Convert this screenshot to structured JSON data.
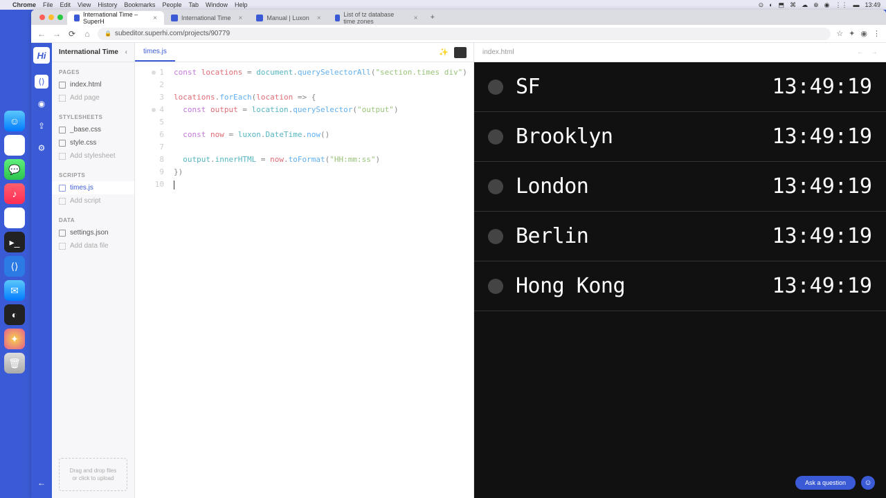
{
  "mac": {
    "app": "Chrome",
    "menus": [
      "File",
      "Edit",
      "View",
      "History",
      "Bookmarks",
      "People",
      "Tab",
      "Window",
      "Help"
    ],
    "time": "13:49"
  },
  "browser": {
    "tabs": [
      {
        "title": "International Time – SuperH",
        "active": true
      },
      {
        "title": "International Time",
        "active": false
      },
      {
        "title": "Manual | Luxon",
        "active": false
      },
      {
        "title": "List of tz database time zones",
        "active": false
      }
    ],
    "url": "subeditor.superhi.com/projects/90779"
  },
  "project": {
    "name": "International Time"
  },
  "sidebar": {
    "sections": {
      "pages": {
        "label": "PAGES",
        "items": [
          "index.html"
        ],
        "add": "Add page"
      },
      "stylesheets": {
        "label": "STYLESHEETS",
        "items": [
          "_base.css",
          "style.css"
        ],
        "add": "Add stylesheet"
      },
      "scripts": {
        "label": "SCRIPTS",
        "items": [
          "times.js"
        ],
        "add": "Add script"
      },
      "data": {
        "label": "DATA",
        "items": [
          "settings.json"
        ],
        "add": "Add data file"
      }
    },
    "dropzone_line1": "Drag and drop files",
    "dropzone_line2": "or click to upload"
  },
  "editor": {
    "active_file": "times.js",
    "lines": [
      {
        "n": 1,
        "dot": true,
        "segments": [
          [
            "kw",
            "const "
          ],
          [
            "var",
            "locations"
          ],
          [
            "pun",
            " = "
          ],
          [
            "prop",
            "document"
          ],
          [
            "pun",
            "."
          ],
          [
            "fn",
            "querySelectorAll"
          ],
          [
            "pun",
            "("
          ],
          [
            "str",
            "\"section.times div\""
          ],
          [
            "pun",
            ")"
          ]
        ]
      },
      {
        "n": 2,
        "segments": []
      },
      {
        "n": 3,
        "segments": [
          [
            "var",
            "locations"
          ],
          [
            "pun",
            "."
          ],
          [
            "fn",
            "forEach"
          ],
          [
            "pun",
            "("
          ],
          [
            "var",
            "location"
          ],
          [
            "pun",
            " => {"
          ]
        ]
      },
      {
        "n": 4,
        "dot": true,
        "indent": 1,
        "segments": [
          [
            "kw",
            "const "
          ],
          [
            "var",
            "output"
          ],
          [
            "pun",
            " = "
          ],
          [
            "prop",
            "location"
          ],
          [
            "pun",
            "."
          ],
          [
            "fn",
            "querySelector"
          ],
          [
            "pun",
            "("
          ],
          [
            "str",
            "\"output\""
          ],
          [
            "pun",
            ")"
          ]
        ]
      },
      {
        "n": 5,
        "segments": []
      },
      {
        "n": 6,
        "indent": 1,
        "segments": [
          [
            "kw",
            "const "
          ],
          [
            "var",
            "now"
          ],
          [
            "pun",
            " = "
          ],
          [
            "prop",
            "luxon"
          ],
          [
            "pun",
            "."
          ],
          [
            "prop",
            "DateTime"
          ],
          [
            "pun",
            "."
          ],
          [
            "fn",
            "now"
          ],
          [
            "pun",
            "()"
          ]
        ]
      },
      {
        "n": 7,
        "segments": []
      },
      {
        "n": 8,
        "indent": 1,
        "segments": [
          [
            "prop",
            "output"
          ],
          [
            "pun",
            "."
          ],
          [
            "prop",
            "innerHTML"
          ],
          [
            "pun",
            " = "
          ],
          [
            "var",
            "now"
          ],
          [
            "pun",
            "."
          ],
          [
            "fn",
            "toFormat"
          ],
          [
            "pun",
            "("
          ],
          [
            "str",
            "\"HH:mm:ss\""
          ],
          [
            "pun",
            ")"
          ]
        ]
      },
      {
        "n": 9,
        "segments": [
          [
            "pun",
            "})"
          ]
        ]
      },
      {
        "n": 10,
        "cursor": true,
        "segments": []
      }
    ]
  },
  "preview": {
    "file": "index.html",
    "cities": [
      {
        "name": "SF",
        "time": "13:49:19"
      },
      {
        "name": "Brooklyn",
        "time": "13:49:19"
      },
      {
        "name": "London",
        "time": "13:49:19"
      },
      {
        "name": "Berlin",
        "time": "13:49:19"
      },
      {
        "name": "Hong Kong",
        "time": "13:49:19"
      }
    ]
  },
  "ask_label": "Ask a question"
}
